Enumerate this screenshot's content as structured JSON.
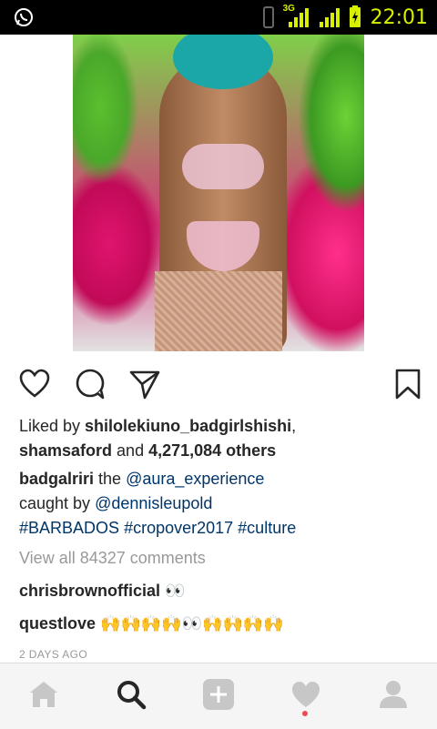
{
  "status_bar": {
    "time": "22:01",
    "network_label": "3G"
  },
  "post": {
    "image_alt": "photo",
    "likes": {
      "prefix": "Liked by ",
      "user1": "shilolekiuno_badgirlshishi",
      "sep": ",",
      "user2": "shamsaford",
      "and": " and ",
      "count": "4,271,084 others"
    },
    "caption": {
      "author": "badgalriri",
      "text1": " the ",
      "mention1": "@aura_experience",
      "text2": "caught by ",
      "mention2": "@dennisleupold",
      "hashtags": [
        "#BARBADOS",
        "#cropover2017",
        "#culture"
      ]
    },
    "view_all_comments": "View all 84327 comments",
    "comments": [
      {
        "user": "chrisbrownofficial",
        "text": "👀"
      },
      {
        "user": "questlove",
        "text": "🙌🙌🙌🙌👀🙌🙌🙌🙌"
      }
    ],
    "time_ago": "2 DAYS AGO"
  },
  "colors": {
    "link": "#003569",
    "muted": "#999999",
    "text": "#262626",
    "notification_dot": "#ed4956"
  }
}
